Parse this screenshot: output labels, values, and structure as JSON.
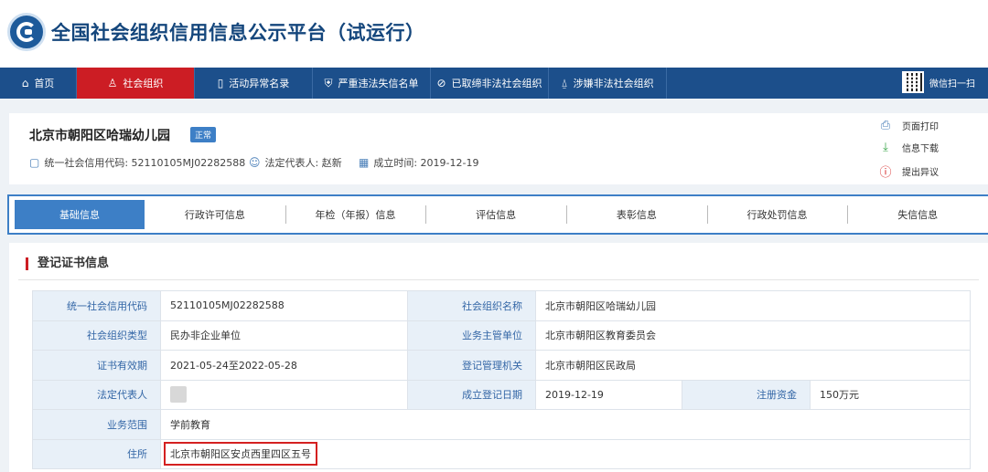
{
  "header": {
    "title": "全国社会组织信用信息公示平台（试运行）"
  },
  "nav": {
    "items": [
      {
        "label": "首页",
        "icon": "⌂"
      },
      {
        "label": "社会组织",
        "icon": "♙"
      },
      {
        "label": "活动异常名录",
        "icon": "▯"
      },
      {
        "label": "严重违法失信名单",
        "icon": "⛨"
      },
      {
        "label": "已取缔非法社会组织",
        "icon": "⊘"
      },
      {
        "label": "涉嫌非法社会组织",
        "icon": "⍙"
      }
    ],
    "qr_label": "微信扫一扫"
  },
  "org": {
    "name": "北京市朝阳区哈瑞幼儿园",
    "status": "正常",
    "credit_code_text": "统一社会信用代码: 52110105MJ02282588",
    "rep_text": "法定代表人: 赵新",
    "founded_text": "成立时间: 2019-12-19"
  },
  "actions": {
    "print": "页面打印",
    "download": "信息下载",
    "objection": "提出异议"
  },
  "tabs": [
    "基础信息",
    "行政许可信息",
    "年检（年报）信息",
    "评估信息",
    "表彰信息",
    "行政处罚信息",
    "失信信息"
  ],
  "section": {
    "title": "登记证书信息"
  },
  "table": {
    "credit_code_label": "统一社会信用代码",
    "credit_code": "52110105MJ02282588",
    "org_name_label": "社会组织名称",
    "org_name": "北京市朝阳区哈瑞幼儿园",
    "org_type_label": "社会组织类型",
    "org_type": "民办非企业单位",
    "supervisor_label": "业务主管单位",
    "supervisor": "北京市朝阳区教育委员会",
    "validity_label": "证书有效期",
    "validity": "2021-05-24至2022-05-28",
    "authority_label": "登记管理机关",
    "authority": "北京市朝阳区民政局",
    "rep_label": "法定代表人",
    "reg_date_label": "成立登记日期",
    "reg_date": "2019-12-19",
    "capital_label": "注册资金",
    "capital": "150万元",
    "scope_label": "业务范围",
    "scope": "学前教育",
    "address_label": "住所",
    "address": "北京市朝阳区安贞西里四区五号"
  },
  "colors": {
    "nav_bg": "#1c4f8b",
    "nav_active": "#cc1d24",
    "accent": "#3d7fc6",
    "label_text": "#3366a6"
  }
}
